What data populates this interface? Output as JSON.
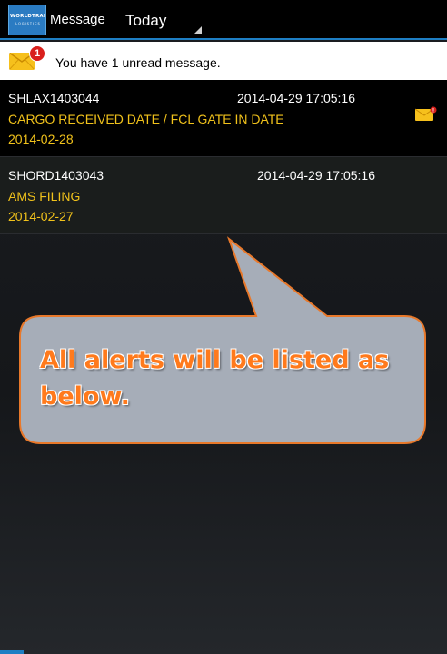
{
  "header": {
    "logo_line1": "WORLDTRANS",
    "logo_line2": "LOGISTICS",
    "app_title": "Message",
    "period": "Today"
  },
  "notice": {
    "badge_count": "1",
    "text": "You have 1 unread message."
  },
  "messages": [
    {
      "ref": "SHLAX1403044",
      "timestamp": "2014-04-29 17:05:16",
      "event": "CARGO RECEIVED DATE / FCL GATE IN DATE",
      "date": "2014-02-28",
      "unread": true
    },
    {
      "ref": "SHORD1403043",
      "timestamp": "2014-04-29 17:05:16",
      "event": "AMS FILING",
      "date": "2014-02-27",
      "unread": false
    }
  ],
  "callout": {
    "text": " All alerts will be listed as below."
  },
  "colors": {
    "accent": "#1e7fc4",
    "event_text": "#f1c21b",
    "callout_text": "#ff7a1c",
    "callout_fill": "#a6adb8",
    "callout_border": "#e8782a"
  }
}
